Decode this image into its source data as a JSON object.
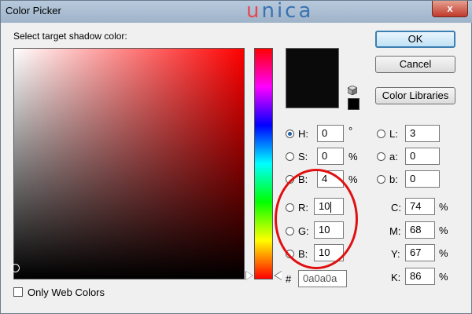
{
  "window": {
    "title": "Color Picker",
    "close_glyph": "x"
  },
  "watermark": {
    "first": "u",
    "rest": "nica"
  },
  "picker": {
    "prompt": "Select target shadow color:",
    "new_color": "#0a0a0a",
    "current_color": "#0a0a0a",
    "hue_color": "#ff0000"
  },
  "buttons": {
    "ok": "OK",
    "cancel": "Cancel",
    "libraries": "Color Libraries"
  },
  "hsb": {
    "h": {
      "label": "H:",
      "value": "0",
      "unit": "°",
      "selected": true
    },
    "s": {
      "label": "S:",
      "value": "0",
      "unit": "%"
    },
    "b": {
      "label": "B:",
      "value": "4",
      "unit": "%"
    }
  },
  "lab": {
    "l": {
      "label": "L:",
      "value": "3"
    },
    "a": {
      "label": "a:",
      "value": "0"
    },
    "b": {
      "label": "b:",
      "value": "0"
    }
  },
  "rgb": {
    "r": {
      "label": "R:",
      "value": "10"
    },
    "g": {
      "label": "G:",
      "value": "10"
    },
    "b": {
      "label": "B:",
      "value": "10"
    }
  },
  "cmyk": {
    "c": {
      "label": "C:",
      "value": "74",
      "unit": "%"
    },
    "m": {
      "label": "M:",
      "value": "68",
      "unit": "%"
    },
    "y": {
      "label": "Y:",
      "value": "67",
      "unit": "%"
    },
    "k": {
      "label": "K:",
      "value": "86",
      "unit": "%"
    }
  },
  "hex": {
    "label": "#",
    "value": "0a0a0a"
  },
  "web_colors": {
    "label": "Only Web Colors",
    "checked": false
  },
  "icons": {
    "cube": "cube-icon",
    "close": "close-icon"
  }
}
